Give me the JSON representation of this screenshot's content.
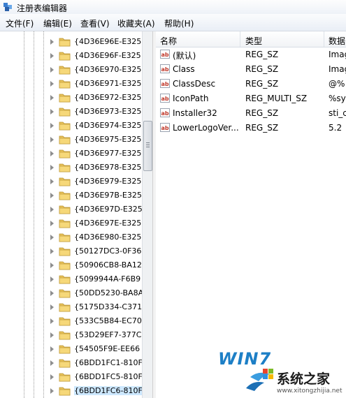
{
  "window": {
    "title": "注册表编辑器"
  },
  "menu": [
    "文件(F)",
    "编辑(E)",
    "查看(V)",
    "收藏夹(A)",
    "帮助(H)"
  ],
  "tree": {
    "items": [
      {
        "label": "{4D36E96E-E325"
      },
      {
        "label": "{4D36E96F-E325"
      },
      {
        "label": "{4D36E970-E325"
      },
      {
        "label": "{4D36E971-E325"
      },
      {
        "label": "{4D36E972-E325"
      },
      {
        "label": "{4D36E973-E325"
      },
      {
        "label": "{4D36E974-E325"
      },
      {
        "label": "{4D36E975-E325"
      },
      {
        "label": "{4D36E977-E325"
      },
      {
        "label": "{4D36E978-E325"
      },
      {
        "label": "{4D36E979-E325"
      },
      {
        "label": "{4D36E97B-E325"
      },
      {
        "label": "{4D36E97D-E325"
      },
      {
        "label": "{4D36E97E-E325"
      },
      {
        "label": "{4D36E980-E325"
      },
      {
        "label": "{50127DC3-0F36"
      },
      {
        "label": "{50906CB8-BA12"
      },
      {
        "label": "{5099944A-F6B9"
      },
      {
        "label": "{50DD5230-BA8A"
      },
      {
        "label": "{5175D334-C371"
      },
      {
        "label": "{533C5B84-EC70"
      },
      {
        "label": "{53D29EF7-377C"
      },
      {
        "label": "{54505F9E-EE66"
      },
      {
        "label": "{6BDD1FC1-810F"
      },
      {
        "label": "{6BDD1FC5-810F"
      },
      {
        "label": "{6BDD1FC6-810F"
      }
    ]
  },
  "list": {
    "columns": [
      "名称",
      "类型",
      "数据"
    ],
    "rows": [
      {
        "name": "(默认)",
        "type": "REG_SZ",
        "data": "Imag"
      },
      {
        "name": "Class",
        "type": "REG_SZ",
        "data": "Imag"
      },
      {
        "name": "ClassDesc",
        "type": "REG_SZ",
        "data": "@%"
      },
      {
        "name": "IconPath",
        "type": "REG_MULTI_SZ",
        "data": "%sy"
      },
      {
        "name": "Installer32",
        "type": "REG_SZ",
        "data": "sti_c"
      },
      {
        "name": "LowerLogoVer...",
        "type": "REG_SZ",
        "data": "5.2"
      }
    ],
    "value_icon_text": "ab"
  },
  "watermark": {
    "brand": "WIN7",
    "site_name": "系统之家",
    "url": "www.xitongzhijia.net"
  }
}
